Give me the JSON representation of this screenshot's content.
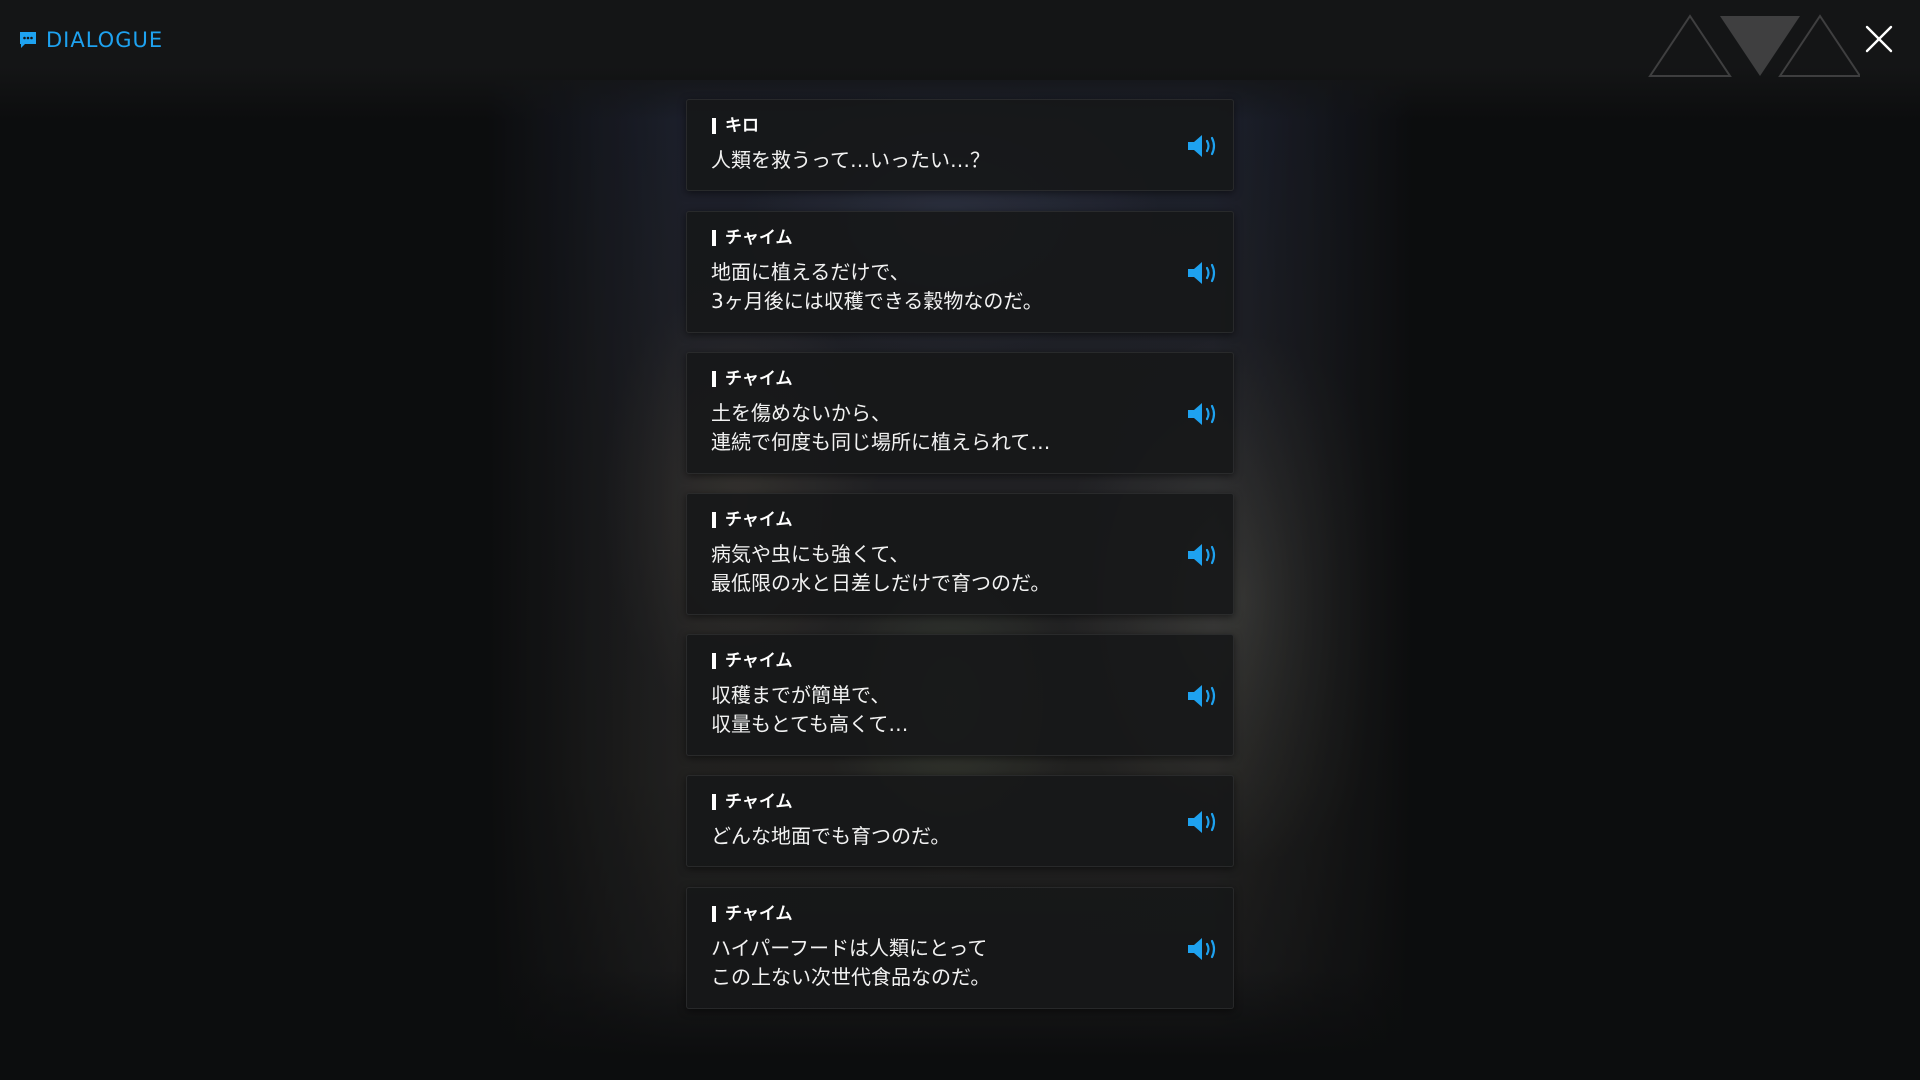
{
  "header": {
    "title": "DIALOGUE",
    "title_icon": "chat-bubble-icon",
    "close_icon": "close-icon",
    "accent_color": "#1ea2f0"
  },
  "dialogue": [
    {
      "speaker": "キロ",
      "lines": [
        "人類を救うって…いったい…？"
      ],
      "voice_icon": "speaker-voice-icon"
    },
    {
      "speaker": "チャイム",
      "lines": [
        "地面に植えるだけで、",
        "3ヶ月後には収穫できる穀物なのだ。"
      ],
      "voice_icon": "speaker-voice-icon"
    },
    {
      "speaker": "チャイム",
      "lines": [
        "土を傷めないから、",
        "連続で何度も同じ場所に植えられて…"
      ],
      "voice_icon": "speaker-voice-icon"
    },
    {
      "speaker": "チャイム",
      "lines": [
        "病気や虫にも強くて、",
        "最低限の水と日差しだけで育つのだ。"
      ],
      "voice_icon": "speaker-voice-icon"
    },
    {
      "speaker": "チャイム",
      "lines": [
        "収穫までが簡単で、",
        "収量もとても高くて…"
      ],
      "voice_icon": "speaker-voice-icon"
    },
    {
      "speaker": "チャイム",
      "lines": [
        "どんな地面でも育つのだ。"
      ],
      "voice_icon": "speaker-voice-icon"
    },
    {
      "speaker": "チャイム",
      "lines": [
        "ハイパーフードは人類にとって",
        "この上ない次世代食品なのだ。"
      ],
      "voice_icon": "speaker-voice-icon"
    }
  ]
}
